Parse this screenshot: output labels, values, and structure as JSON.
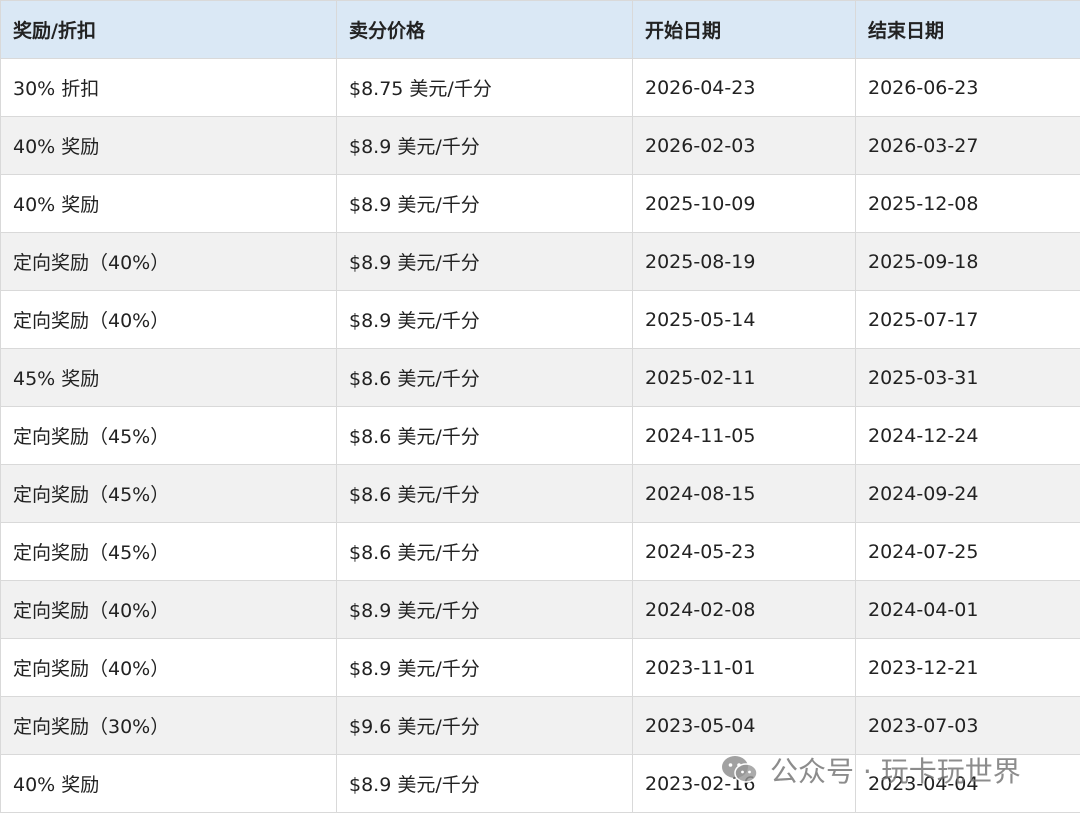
{
  "table": {
    "headers": [
      "奖励/折扣",
      "卖分价格",
      "开始日期",
      "结束日期"
    ],
    "rows": [
      [
        "30% 折扣",
        "$8.75 美元/千分",
        "2026-04-23",
        "2026-06-23"
      ],
      [
        "40% 奖励",
        "$8.9 美元/千分",
        "2026-02-03",
        "2026-03-27"
      ],
      [
        "40% 奖励",
        "$8.9 美元/千分",
        "2025-10-09",
        "2025-12-08"
      ],
      [
        "定向奖励（40%）",
        "$8.9 美元/千分",
        "2025-08-19",
        "2025-09-18"
      ],
      [
        "定向奖励（40%）",
        "$8.9 美元/千分",
        "2025-05-14",
        "2025-07-17"
      ],
      [
        "45% 奖励",
        "$8.6 美元/千分",
        "2025-02-11",
        "2025-03-31"
      ],
      [
        "定向奖励（45%）",
        "$8.6 美元/千分",
        "2024-11-05",
        "2024-12-24"
      ],
      [
        "定向奖励（45%）",
        "$8.6 美元/千分",
        "2024-08-15",
        "2024-09-24"
      ],
      [
        "定向奖励（45%）",
        "$8.6 美元/千分",
        "2024-05-23",
        "2024-07-25"
      ],
      [
        "定向奖励（40%）",
        "$8.9 美元/千分",
        "2024-02-08",
        "2024-04-01"
      ],
      [
        "定向奖励（40%）",
        "$8.9 美元/千分",
        "2023-11-01",
        "2023-12-21"
      ],
      [
        "定向奖励（30%）",
        "$9.6 美元/千分",
        "2023-05-04",
        "2023-07-03"
      ],
      [
        "40% 奖励",
        "$8.9 美元/千分",
        "2023-02-16",
        "2023-04-04"
      ]
    ]
  },
  "watermark": {
    "text": "公众号 · 玩卡玩世界",
    "icon": "wechat-icon"
  },
  "colors": {
    "header_bg": "#dae8f5",
    "stripe_bg": "#f1f1f1",
    "border": "#d9d9d9",
    "text": "#222222"
  }
}
